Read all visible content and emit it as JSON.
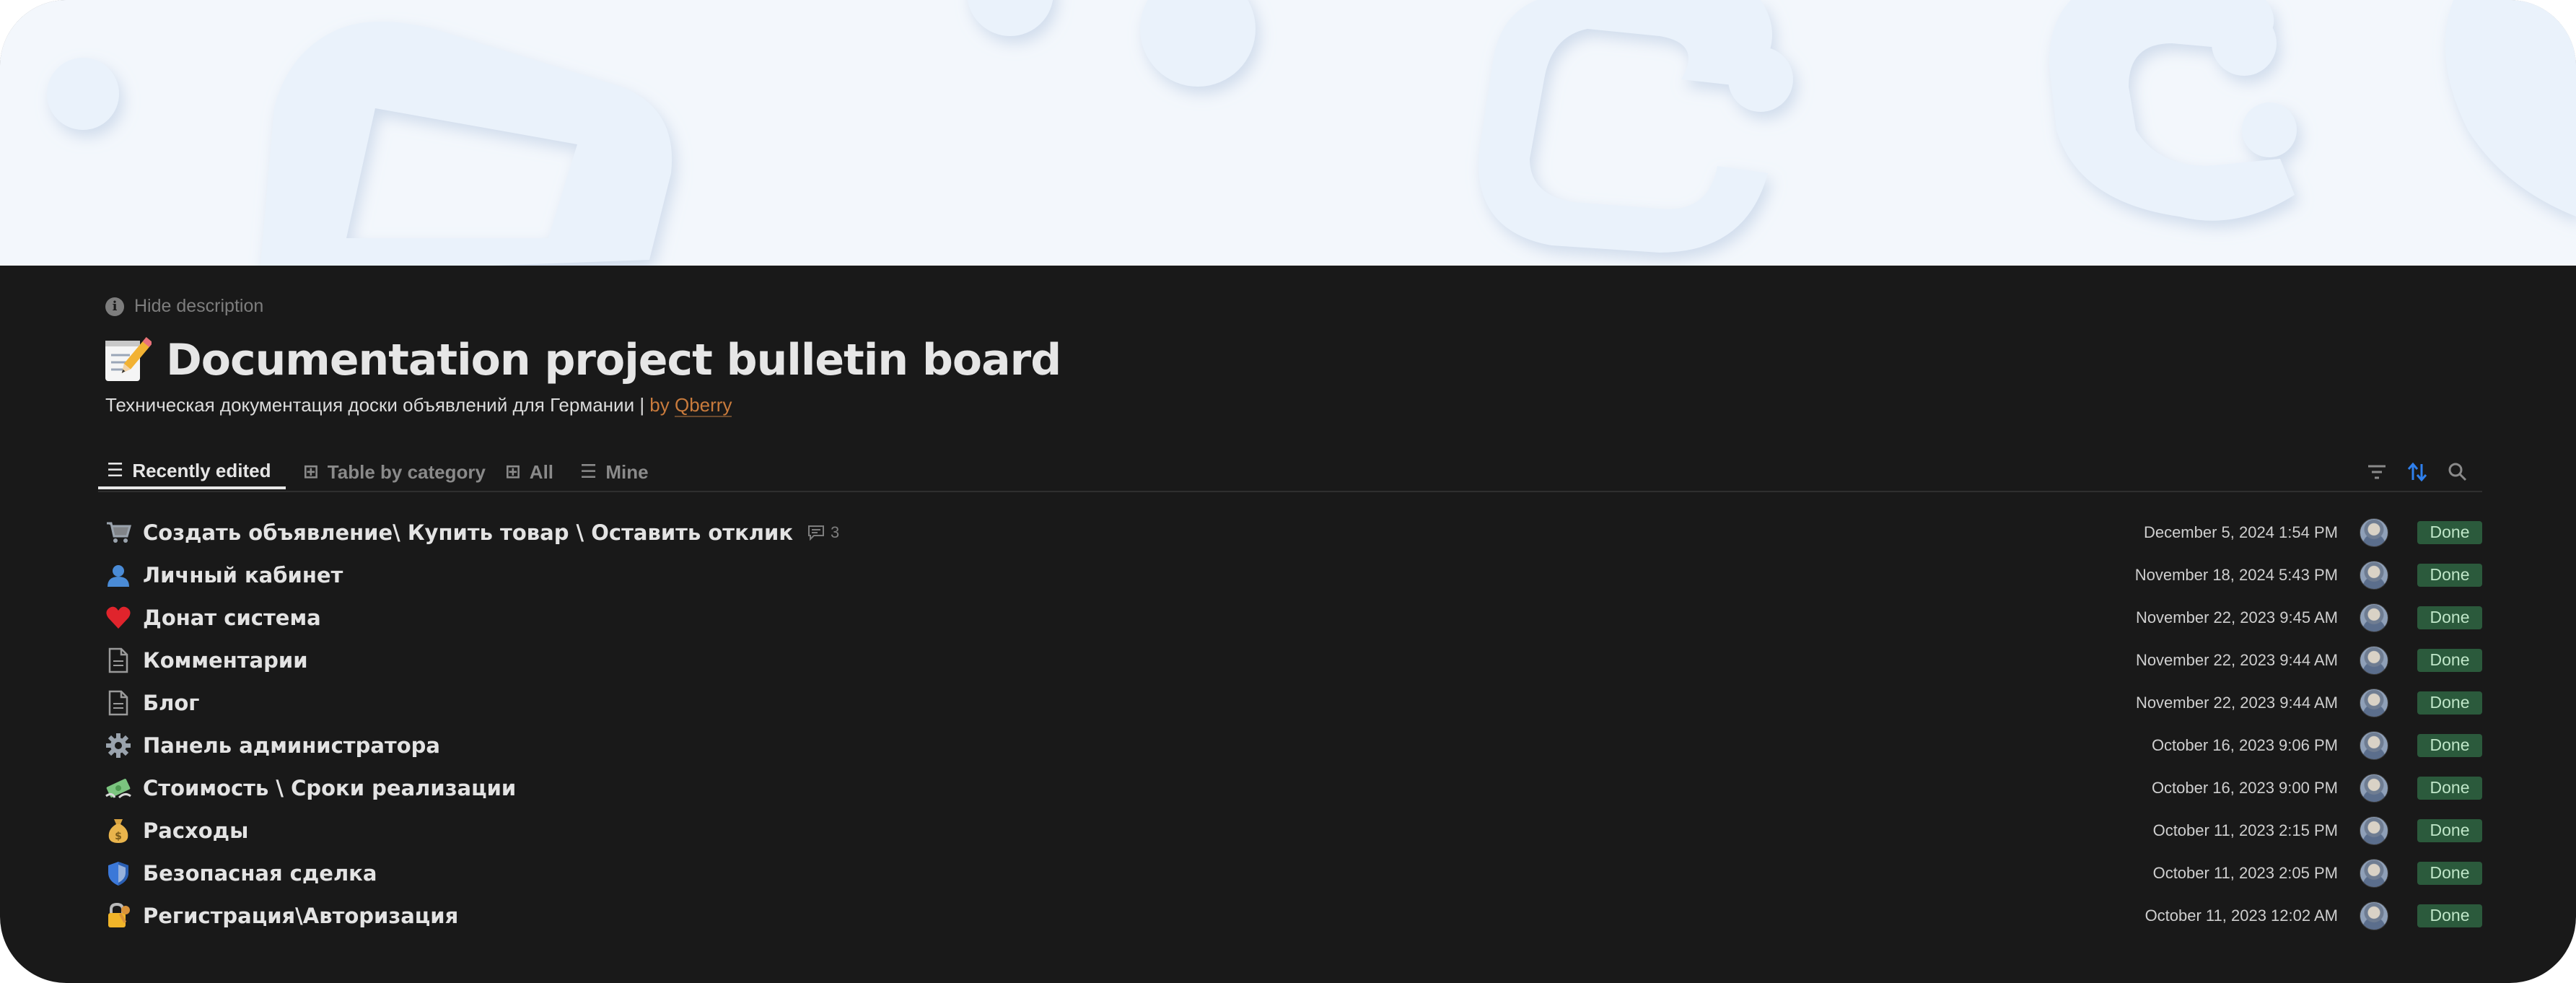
{
  "page": {
    "hide_description": "Hide description",
    "title": "Documentation project bulletin board",
    "title_icon": "memo-icon",
    "subtitle_text": "Техническая документация доски объявлений для Германии | ",
    "subtitle_by": "by ",
    "subtitle_author": "Qberry"
  },
  "tabs": [
    {
      "label": "Recently edited",
      "icon": "list-icon",
      "active": true
    },
    {
      "label": "Table by category",
      "icon": "table-icon",
      "active": false
    },
    {
      "label": "All",
      "icon": "table-icon",
      "active": false
    },
    {
      "label": "Mine",
      "icon": "list-icon",
      "active": false
    }
  ],
  "toolbar": {
    "filter_icon": "filter-icon",
    "sort_icon": "sort-icon",
    "search_icon": "search-icon",
    "accent": "#2f80ed"
  },
  "rows": [
    {
      "icon": "cart-icon",
      "title": "Создать объявление\\ Купить товар \\ Оставить отклик",
      "comments": "3",
      "date": "December 5, 2024 1:54 PM",
      "status": "Done"
    },
    {
      "icon": "user-icon",
      "title": "Личный кабинет",
      "comments": "",
      "date": "November 18, 2024 5:43 PM",
      "status": "Done"
    },
    {
      "icon": "heart-icon",
      "title": "Донат система",
      "comments": "",
      "date": "November 22, 2023 9:45 AM",
      "status": "Done"
    },
    {
      "icon": "page-icon",
      "title": "Комментарии",
      "comments": "",
      "date": "November 22, 2023 9:44 AM",
      "status": "Done"
    },
    {
      "icon": "page-icon",
      "title": "Блог",
      "comments": "",
      "date": "November 22, 2023 9:44 AM",
      "status": "Done"
    },
    {
      "icon": "gear-icon",
      "title": "Панель администратора",
      "comments": "",
      "date": "October 16, 2023 9:06 PM",
      "status": "Done"
    },
    {
      "icon": "money-wings-icon",
      "title": "Стоимость \\ Сроки реализации",
      "comments": "",
      "date": "October 16, 2023 9:00 PM",
      "status": "Done"
    },
    {
      "icon": "money-bag-icon",
      "title": "Расходы",
      "comments": "",
      "date": "October 11, 2023 2:15 PM",
      "status": "Done"
    },
    {
      "icon": "shield-icon",
      "title": "Безопасная сделка",
      "comments": "",
      "date": "October 11, 2023 2:05 PM",
      "status": "Done"
    },
    {
      "icon": "lock-key-icon",
      "title": "Регистрация\\Авторизация",
      "comments": "",
      "date": "October 11, 2023 12:02 AM",
      "status": "Done"
    }
  ],
  "colors": {
    "background": "#191919",
    "status_done_bg": "#2b5a3c",
    "status_done_text": "#bfe6c8",
    "cover": "#f3f7fc",
    "author_link": "#c97b3c"
  }
}
